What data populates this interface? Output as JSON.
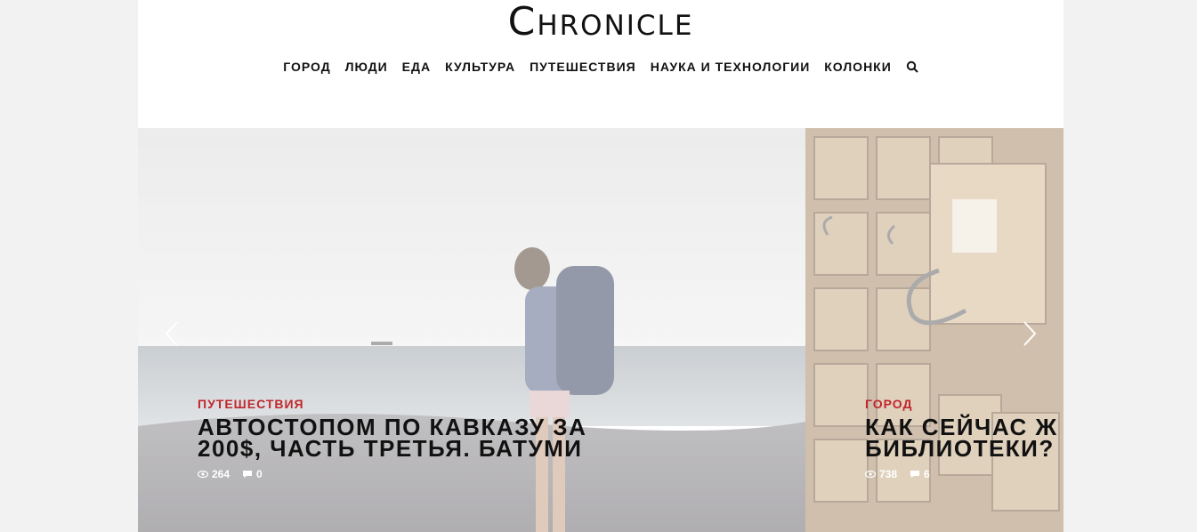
{
  "site": {
    "logo": "Chronicle"
  },
  "nav": {
    "items": [
      "ГОРОД",
      "ЛЮДИ",
      "ЕДА",
      "КУЛЬТУРА",
      "ПУТЕШЕСТВИЯ",
      "НАУКА И ТЕХНОЛОГИИ",
      "КОЛОНКИ"
    ],
    "search_icon": "search-icon"
  },
  "slides": [
    {
      "category": "ПУТЕШЕСТВИЯ",
      "title_line1": "АВТОСТОПОМ ПО КАВКАЗУ ЗА",
      "title_line2": "200$, ЧАСТЬ ТРЕТЬЯ. БАТУМИ",
      "views": "264",
      "comments": "0"
    },
    {
      "category": "ГОРОД",
      "title_line1": "КАК СЕЙЧАС Ж",
      "title_line2": "БИБЛИОТЕКИ?",
      "views": "738",
      "comments": "6"
    }
  ],
  "colors": {
    "category": "#c0272d",
    "background": "#f2f2f2"
  }
}
